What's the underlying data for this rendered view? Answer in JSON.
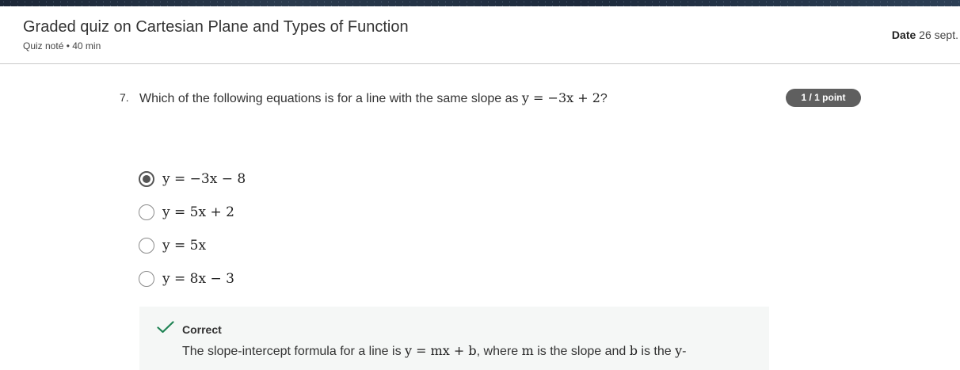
{
  "header": {
    "title": "Graded quiz on Cartesian Plane and Types of Function",
    "subtitle": "Quiz noté • 40 min",
    "date_label": "Date",
    "date_value": "26 sept."
  },
  "question": {
    "number": "7.",
    "text_before": "Which of the following equations is for a line with the same slope as ",
    "equation": "y = −3x + 2",
    "text_after": "?",
    "score_badge": "1 / 1 point"
  },
  "options": [
    {
      "label": "y = −3x − 8",
      "selected": true
    },
    {
      "label": "y = 5x + 2",
      "selected": false
    },
    {
      "label": "y = 5x",
      "selected": false
    },
    {
      "label": "y = 8x − 3",
      "selected": false
    }
  ],
  "feedback": {
    "title": "Correct",
    "text_1": "The slope-intercept formula for a line is ",
    "eq_1": "y = mx + b",
    "text_2": ", where ",
    "var_m": "m",
    "text_3": " is the slope and ",
    "var_b": "b",
    "text_4": " is the ",
    "var_y": "y",
    "text_5": "-"
  },
  "colors": {
    "badge_bg": "#5f5f5f",
    "check_green": "#1f8354",
    "feedback_bg": "#f5f7f6"
  }
}
